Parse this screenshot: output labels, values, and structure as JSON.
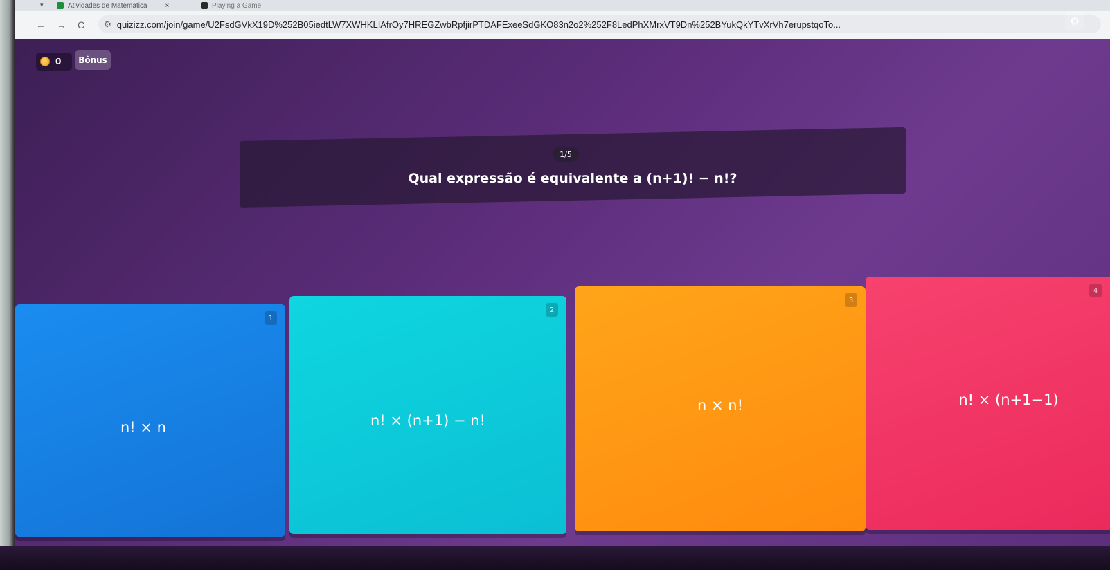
{
  "browser": {
    "tabs": [
      {
        "title": "Atividades de Matematica",
        "close": "×"
      },
      {
        "title": "Playing a Game"
      }
    ],
    "nav": {
      "back": "←",
      "forward": "→",
      "reload": "C"
    },
    "url": "quizizz.com/join/game/U2FsdGVkX19D%252B05iedtLW7XWHKLIAfrOy7HREGZwbRpfjirPTDAFExeeSdGKO83n2o2%252F8LedPhXMrxVT9Dn%252BYukQkYTvXrVh7erupstqoTo..."
  },
  "game": {
    "score": "0",
    "bonus_label": "Bônus",
    "settings_icon": "gear-icon",
    "coin_color": "#f2a31b"
  },
  "question": {
    "counter": "1/5",
    "text": "Qual expressão é equivalente a (n+1)! − n!?"
  },
  "options": [
    {
      "number": "1",
      "label": "n! × n",
      "color": "#1a8cf0"
    },
    {
      "number": "2",
      "label": "n! × (n+1) − n!",
      "color": "#0fd6e0"
    },
    {
      "number": "3",
      "label": "n × n!",
      "color": "#ffa51a"
    },
    {
      "number": "4",
      "label": "n! × (n+1−1)",
      "color": "#f7426e"
    }
  ]
}
